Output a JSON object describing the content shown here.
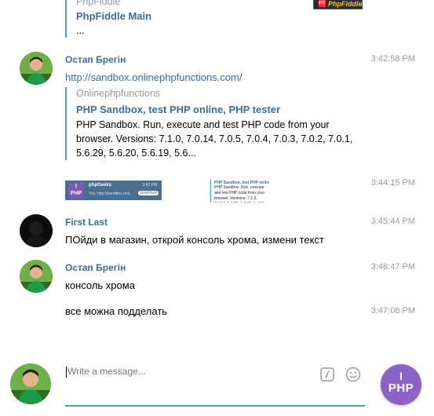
{
  "messages": {
    "top_quote": {
      "site": "PhpFiddle",
      "title": "PhpFiddle Main",
      "desc": "..."
    },
    "m1": {
      "author": "Остап Брегін",
      "time": "3:42:58 PM",
      "link": "http://sandbox.onlinephpfunctions.com/",
      "preview_site": "Onlinephpfunctions",
      "preview_title": "PHP Sandbox, test PHP online, PHP tester",
      "preview_desc": "PHP Sandbox. Run, execute and test PHP code from your browser. Versions: 7.1.0, 7.0.14, 7.0.5, 7.0.4, 7.0.3, 7.0.2, 7.0.1, 5.6.29, 5.6.20, 5.6.19, 5.6..."
    },
    "m2": {
      "time": "3:44:15 PM",
      "thumb1_title": "phpGeeks",
      "thumb1_time": "3:42 PM",
      "thumb1_text": "You: http://sandbox.onli...",
      "thumb1_badge": "undefined",
      "thumb2_title": "PHP Sandbox, test PHP online",
      "thumb2_text": "PHP Sandbox. Run, execute and test PHP code from your browser. Versions: 7.1.0, 7.0.14, 5.6.29, 5.6.20, 5.6.19, 5.6..."
    },
    "m3": {
      "author": "First Last",
      "time": "3:45:44 PM",
      "text": "ПОйди в магазин, открой консоль хрома, измени текст"
    },
    "m4": {
      "author": "Остап Брегін",
      "time": "3:46:47 PM",
      "text": "консоль хрома"
    },
    "m5": {
      "time": "3:47:06 PM",
      "text": "все можна подделать"
    }
  },
  "composer": {
    "placeholder": "Write a message...",
    "command_icon": "slash-command-icon",
    "emoji_icon": "emoji-icon"
  },
  "badges": {
    "top_fiddle_label": "PhpFiddle",
    "php_logo_line1": "I",
    "php_logo_line2": "PHP"
  },
  "colors": {
    "accent": "#3a6d99",
    "quote_bar": "#4f9ad0",
    "timestamp": "#999999",
    "php_logo_bg": "#8a63c9"
  }
}
